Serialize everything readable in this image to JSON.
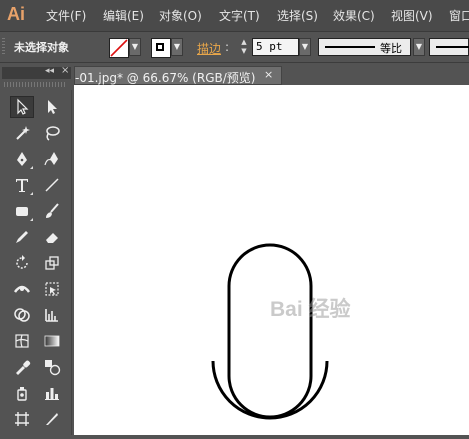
{
  "app": {
    "logo": "Ai"
  },
  "menu": [
    "文件(F)",
    "编辑(E)",
    "对象(O)",
    "文字(T)",
    "选择(S)",
    "效果(C)",
    "视图(V)",
    "窗口"
  ],
  "control_bar": {
    "selection_status": "未选择对象",
    "fill_color": "none",
    "stroke_color": "#000000",
    "stroke_label": "描边",
    "stroke_colon": ":",
    "stroke_weight": "5 pt",
    "profile_label": "等比"
  },
  "tools_panel": {
    "collapse": "◂◂",
    "close": "×"
  },
  "document": {
    "tab_title": "-01.jpg* @ 66.67% (RGB/预览)",
    "tab_close": "×"
  },
  "canvas": {
    "shape": "microphone-outline",
    "stroke_color": "#000000",
    "background": "#ffffff"
  },
  "watermark": "Bai 经验"
}
